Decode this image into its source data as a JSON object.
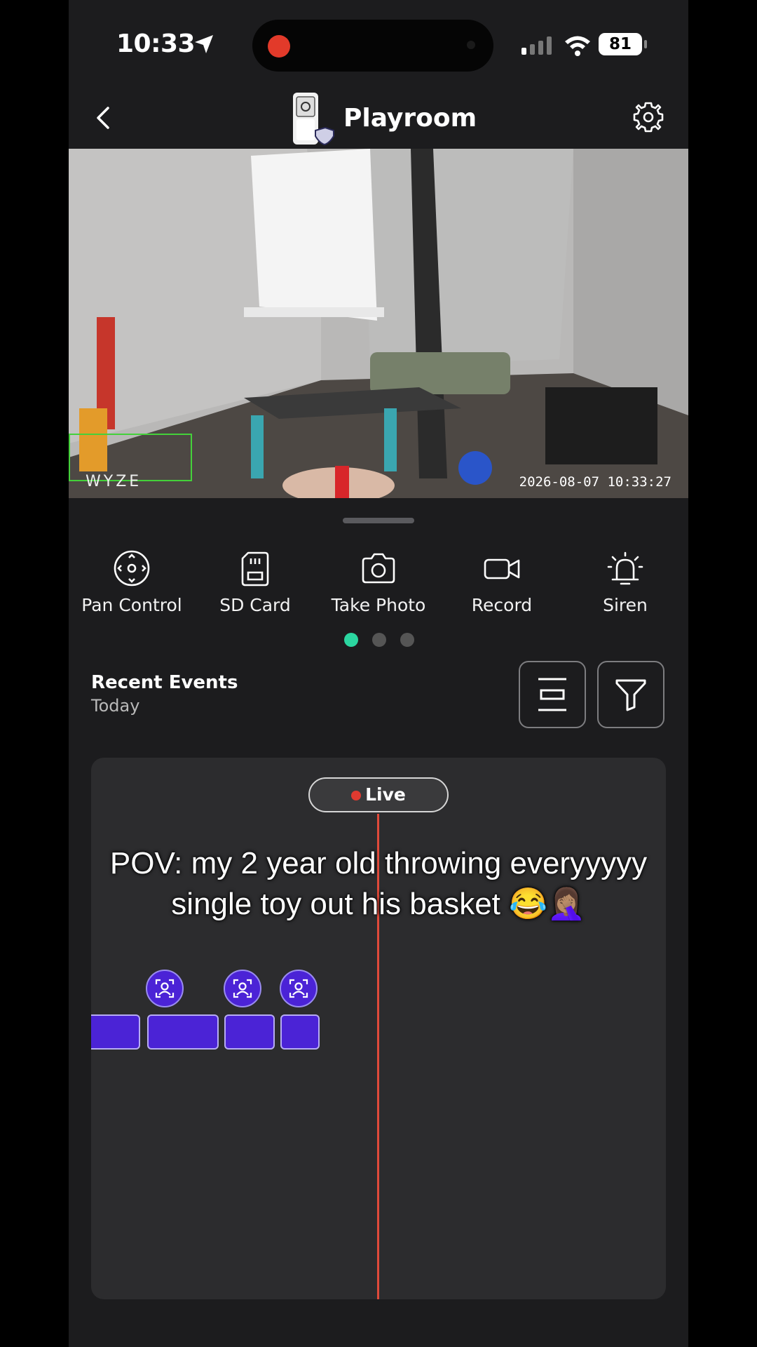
{
  "status_bar": {
    "time": "10:33",
    "battery": "81"
  },
  "header": {
    "title": "Playroom"
  },
  "camera": {
    "watermark": "WYZE",
    "timestamp": "2026-08-07 10:33:27"
  },
  "actions": [
    {
      "label": "Pan Control",
      "icon": "pan-control-icon"
    },
    {
      "label": "SD Card",
      "icon": "sd-card-icon"
    },
    {
      "label": "Take Photo",
      "icon": "camera-icon"
    },
    {
      "label": "Record",
      "icon": "video-icon"
    },
    {
      "label": "Siren",
      "icon": "siren-icon"
    }
  ],
  "pager": {
    "active_index": 0,
    "count": 3,
    "active_color": "#2bd6a0"
  },
  "events": {
    "title": "Recent Events",
    "subtitle": "Today"
  },
  "timeline": {
    "live_label": "Live"
  },
  "caption": {
    "line1": "POV: my 2 year old throwing everyyyyy",
    "line2": "single toy out his basket 😂🤦🏽‍♀️"
  },
  "colors": {
    "accent": "#4b23d6",
    "live": "#e03a30"
  }
}
